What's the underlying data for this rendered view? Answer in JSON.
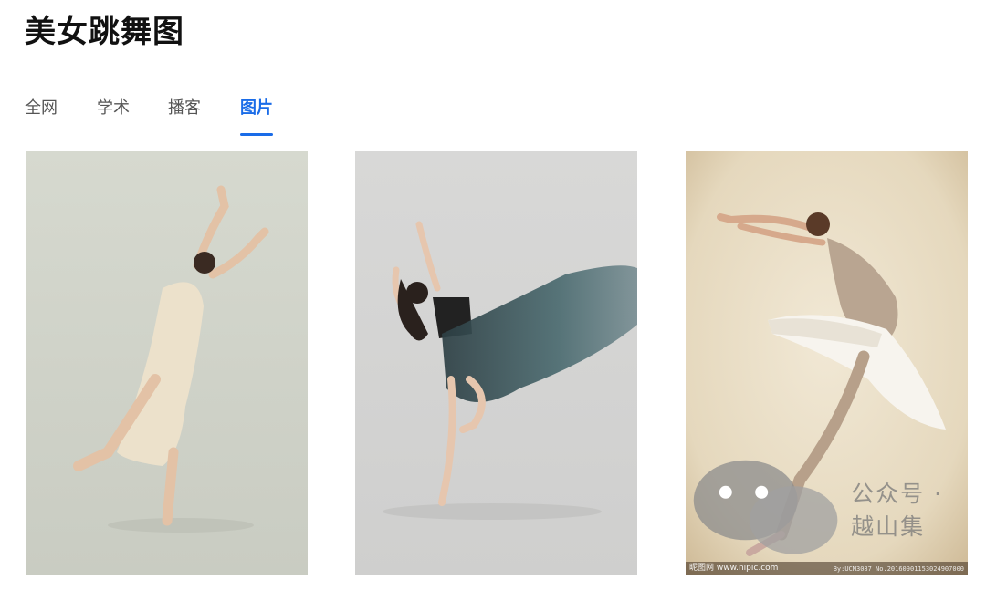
{
  "page": {
    "title": "美女跳舞图"
  },
  "tabs": [
    {
      "label": "全网",
      "active": false
    },
    {
      "label": "学术",
      "active": false
    },
    {
      "label": "播客",
      "active": false
    },
    {
      "label": "图片",
      "active": true
    }
  ],
  "images": [
    {
      "subject": "Dancer in cream qipao reaching upward"
    },
    {
      "subject": "Dancer with flowing teal silk skirt"
    },
    {
      "subject": "Ballerina in white tutu leaping backward"
    }
  ],
  "watermark": {
    "text": "公众号 · 越山集",
    "site_mark": "昵图网 www.nipic.com",
    "site_id": "By:UCM3087 No.20160901153024907000"
  },
  "colors": {
    "accent": "#1a6ce8"
  }
}
